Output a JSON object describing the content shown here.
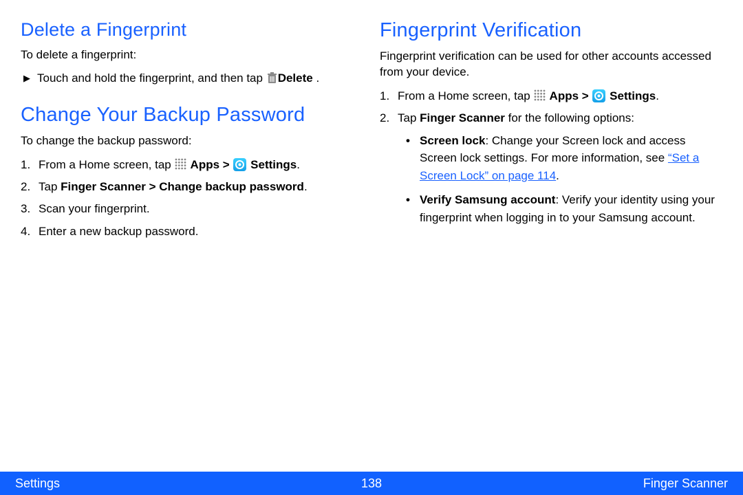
{
  "left": {
    "h_delete": "Delete a Fingerprint",
    "p_delete": "To delete a fingerprint:",
    "delete_step_a": "Touch and hold the fingerprint, and then tap ",
    "delete_step_b": "Delete",
    "delete_step_c": " .",
    "h_change": "Change Your Backup Password",
    "p_change": "To change the backup password:",
    "steps": {
      "s1a": "From a Home screen, tap ",
      "s1b": " Apps > ",
      "s1c": " Settings",
      "s1d": ".",
      "s2a": "Tap ",
      "s2b": "Finger Scanner > Change backup password",
      "s2c": ".",
      "s3": "Scan your fingerprint.",
      "s4": "Enter a new backup password."
    }
  },
  "right": {
    "h_verify": "Fingerprint Verification",
    "p_verify": "Fingerprint verification can be used for other accounts accessed from your device.",
    "steps": {
      "s1a": "From a Home screen, tap ",
      "s1b": " Apps > ",
      "s1c": " Settings",
      "s1d": ".",
      "s2a": "Tap ",
      "s2b": "Finger Scanner",
      "s2c": " for the following options:"
    },
    "bullets": {
      "b1a": "Screen lock",
      "b1b": ": Change your Screen lock and access Screen lock settings. For more information, see ",
      "b1c": "“Set a Screen Lock” on page 114",
      "b1d": ".",
      "b2a": "Verify Samsung account",
      "b2b": ": Verify your identity using your fingerprint when logging in to your Samsung account."
    }
  },
  "footer": {
    "left": "Settings",
    "mid": "138",
    "right": "Finger Scanner"
  }
}
